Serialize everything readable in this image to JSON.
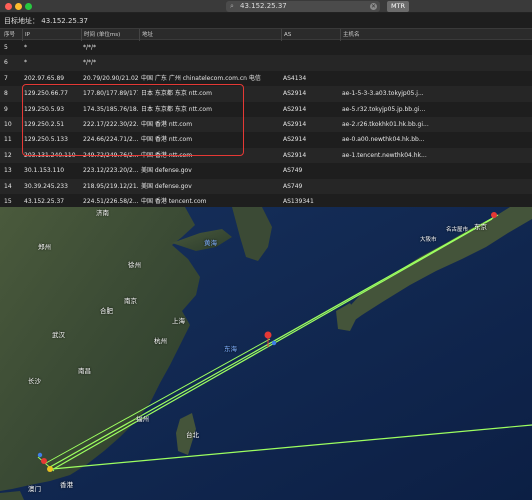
{
  "toolbar": {
    "search_value": "43.152.25.37",
    "mtr_label": "MTR"
  },
  "target": {
    "label": "目标地址：",
    "address": "43.152.25.37"
  },
  "columns": {
    "no": "序号",
    "ip": "IP",
    "time": "时间 (单位ms)",
    "addr": "地址",
    "as": "AS",
    "host": "主机名"
  },
  "rows": [
    {
      "no": "5",
      "ip": "*",
      "time": "*/*/*",
      "addr": "",
      "as": "",
      "host": ""
    },
    {
      "no": "6",
      "ip": "*",
      "time": "*/*/*",
      "addr": "",
      "as": "",
      "host": ""
    },
    {
      "no": "7",
      "ip": "202.97.65.89",
      "time": "20.79/20.90/21.02",
      "addr": "中国 广东 广州 chinatelecom.com.cn 电信",
      "as": "AS4134",
      "host": ""
    },
    {
      "no": "8",
      "ip": "129.250.66.77",
      "time": "177.80/177.89/177...",
      "addr": "日本 东京都 东京 ntt.com",
      "as": "AS2914",
      "host": "ae-1-5-3-3.a03.tokyjp05.j..."
    },
    {
      "no": "9",
      "ip": "129.250.5.93",
      "time": "174.35/185.76/18...",
      "addr": "日本 东京都 东京 ntt.com",
      "as": "AS2914",
      "host": "ae-5.r32.tokyjp05.jp.bb.gi..."
    },
    {
      "no": "10",
      "ip": "129.250.2.51",
      "time": "222.17/222.30/22...",
      "addr": "中国 香港 ntt.com",
      "as": "AS2914",
      "host": "ae-2.r26.tkokhk01.hk.bb.gi..."
    },
    {
      "no": "11",
      "ip": "129.250.5.133",
      "time": "224.66/224.71/2...",
      "addr": "中国 香港 ntt.com",
      "as": "AS2914",
      "host": "ae-0.a00.newthk04.hk.bb..."
    },
    {
      "no": "12",
      "ip": "203.131.240.110",
      "time": "249.72/249.76/2...",
      "addr": "中国 香港 ntt.com",
      "as": "AS2914",
      "host": "ae-1.tencent.newthk04.hk..."
    },
    {
      "no": "13",
      "ip": "30.1.153.110",
      "time": "223.12/223.20/2...",
      "addr": "美国 defense.gov",
      "as": "AS749",
      "host": ""
    },
    {
      "no": "14",
      "ip": "30.39.245.233",
      "time": "218.95/219.12/21...",
      "addr": "美国 defense.gov",
      "as": "AS749",
      "host": ""
    },
    {
      "no": "15",
      "ip": "43.152.25.37",
      "time": "224.51/226.58/2...",
      "addr": "中国 香港 tencent.com",
      "as": "AS139341",
      "host": ""
    }
  ],
  "map": {
    "labels": {
      "jinan": "济南",
      "zhengzhou": "郑州",
      "xuzhou": "徐州",
      "bohai": "渤海",
      "yellow_sea": "黄海",
      "nanjing": "南京",
      "hefei": "合肥",
      "wuhan": "武汉",
      "shanghai": "上海",
      "hangzhou": "杭州",
      "east_sea": "东海",
      "changsha": "长沙",
      "nanchang": "南昌",
      "fuzhou": "福州",
      "taipei": "台北",
      "macau": "澳门",
      "hongkong": "香港",
      "osaka": "大阪市",
      "nagoya": "名古屋市",
      "tokyo": "东京"
    }
  }
}
